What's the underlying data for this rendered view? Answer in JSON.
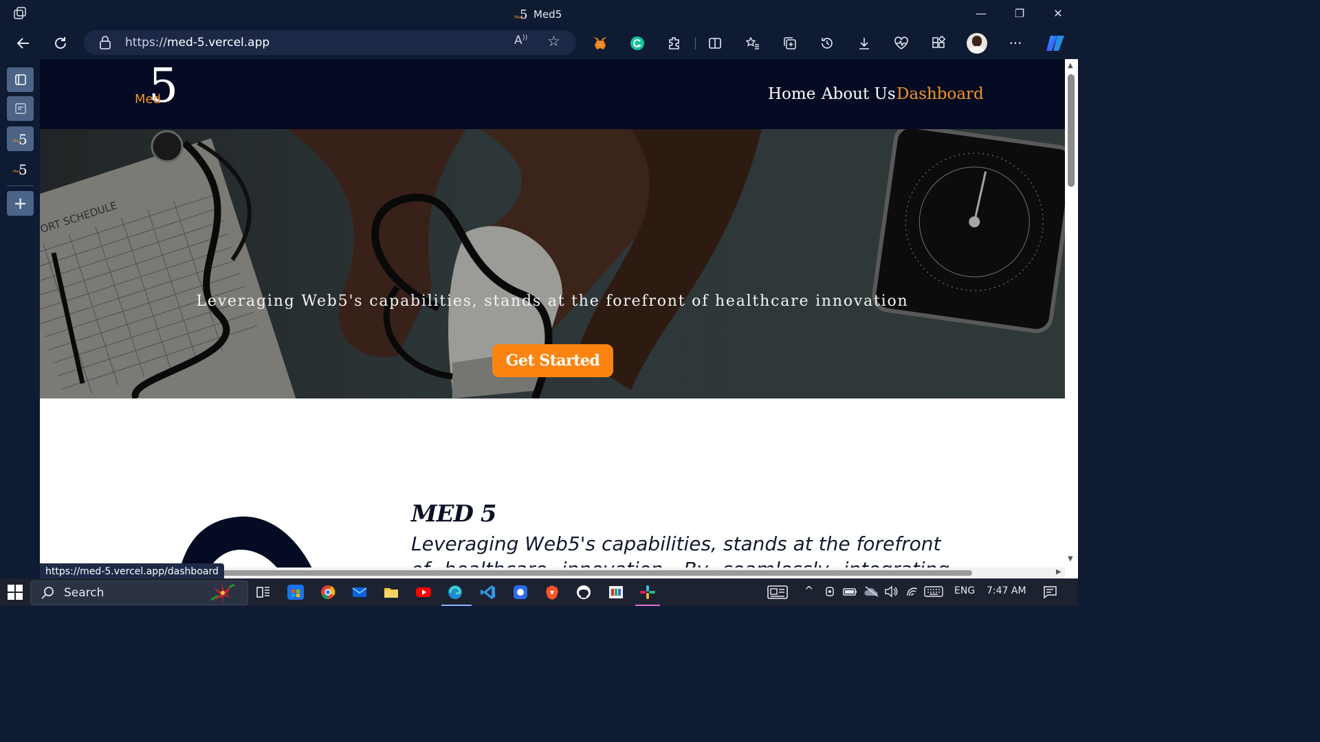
{
  "browser": {
    "window_title": "Med5",
    "url_scheme": "https://",
    "url_host": "med-5.vercel.app",
    "status_link": "https://med-5.vercel.app/dashboard"
  },
  "site": {
    "logo_text": "Med",
    "logo_numeral": "5",
    "nav": {
      "home": "Home",
      "about": "About Us",
      "dashboard": "Dashboard"
    },
    "hero": {
      "tagline": "Leveraging Web5's capabilities, stands at the forefront of healthcare innovation",
      "cta": "Get Started"
    },
    "about": {
      "heading": "MED 5",
      "line1": "Leveraging Web5's capabilities, stands at the forefront",
      "line2": "of healthcare innovation. By seamlessly integrating"
    }
  },
  "taskbar": {
    "search_label": "Search",
    "language": "ENG",
    "time": "7:47 AM"
  },
  "colors": {
    "accent": "#f29427",
    "cta": "#fb8410",
    "site_nav_bg": "#040b22",
    "browser_chrome": "#0f1a33"
  }
}
